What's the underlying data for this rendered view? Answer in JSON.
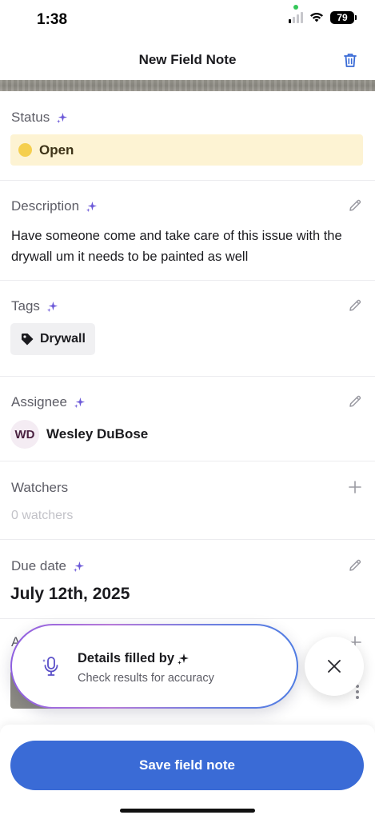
{
  "status_bar": {
    "time": "1:38",
    "battery": "79"
  },
  "header": {
    "title": "New Field Note",
    "trash_icon": "trash-icon"
  },
  "status": {
    "label": "Status",
    "value": "Open",
    "color": "#fdf3d3"
  },
  "description": {
    "label": "Description",
    "text": "Have someone come and take care of this issue with the drywall um it needs to be painted as well"
  },
  "tags": {
    "label": "Tags",
    "items": [
      "Drywall"
    ]
  },
  "assignee": {
    "label": "Assignee",
    "initials": "WD",
    "name": "Wesley DuBose"
  },
  "watchers": {
    "label": "Watchers",
    "empty_text": "0 watchers"
  },
  "due_date": {
    "label": "Due date",
    "value": "July 12th, 2025"
  },
  "attachments": {
    "label_partial": "A"
  },
  "toast": {
    "title": "Details filled by",
    "subtitle": "Check results for accuracy"
  },
  "footer": {
    "save_label": "Save field note",
    "accent": "#3a6bd6"
  }
}
